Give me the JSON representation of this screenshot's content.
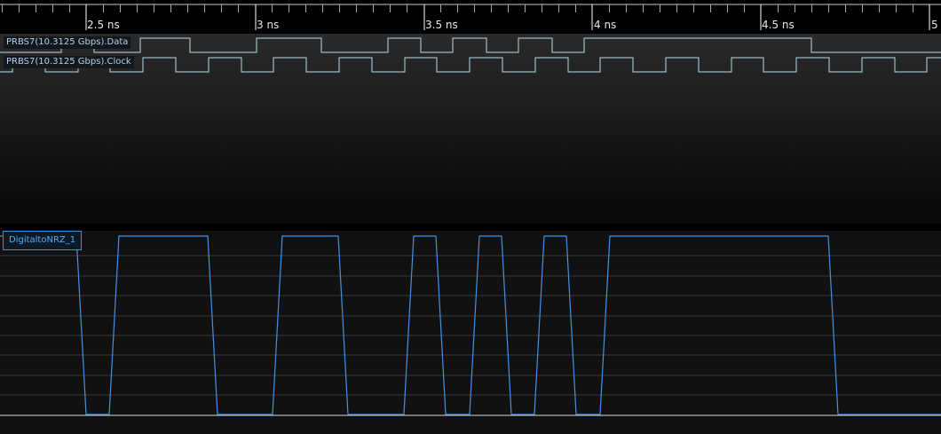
{
  "ruler": {
    "tick_labels": [
      "2.5 ns",
      "3 ns",
      "3.5 ns",
      "4 ns",
      "4.5 ns",
      "5"
    ]
  },
  "digital_traces": [
    {
      "label": "PRBS7(10.3125 Gbps).Data",
      "color": "#b9dce6"
    },
    {
      "label": "PRBS7(10.3125 Gbps).Clock",
      "color": "#b9dce6"
    }
  ],
  "analog_trace": {
    "label": "DigitaltoNRZ_1",
    "color": "#3f94e6"
  }
}
